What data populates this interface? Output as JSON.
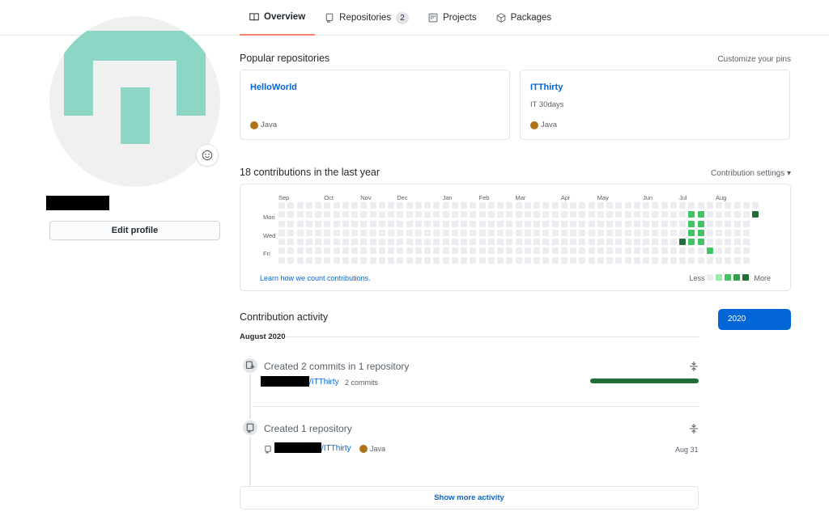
{
  "nav": {
    "tabs": [
      {
        "label": "Overview",
        "icon": "book-icon",
        "active": true
      },
      {
        "label": "Repositories",
        "icon": "repo-icon",
        "count": "2"
      },
      {
        "label": "Projects",
        "icon": "project-icon"
      },
      {
        "label": "Packages",
        "icon": "package-icon"
      }
    ]
  },
  "profile": {
    "avatar_color": "#8dd5c5",
    "edit_label": "Edit profile"
  },
  "popular": {
    "title": "Popular repositories",
    "customize_label": "Customize your pins",
    "repos": [
      {
        "name": "HelloWorld",
        "description": "",
        "language": "Java",
        "language_color": "#b07219"
      },
      {
        "name": "ITThirty",
        "description": "IT 30days",
        "language": "Java",
        "language_color": "#b07219"
      }
    ]
  },
  "contributions": {
    "title": "18 contributions in the last year",
    "settings_label": "Contribution settings ▾",
    "months": [
      "Sep",
      "Oct",
      "Nov",
      "Dec",
      "Jan",
      "Feb",
      "Mar",
      "Apr",
      "May",
      "Jun",
      "Jul",
      "Aug"
    ],
    "days": [
      "Mon",
      "Wed",
      "Fri"
    ],
    "weeks": 53,
    "levels": [
      "#ebedf0",
      "#9be9a8",
      "#40c463",
      "#30a14e",
      "#216e39"
    ],
    "active_cells": [
      {
        "week": 45,
        "day": 1,
        "level": 2
      },
      {
        "week": 46,
        "day": 1,
        "level": 2
      },
      {
        "week": 45,
        "day": 2,
        "level": 2
      },
      {
        "week": 46,
        "day": 2,
        "level": 2
      },
      {
        "week": 45,
        "day": 3,
        "level": 2
      },
      {
        "week": 46,
        "day": 3,
        "level": 2
      },
      {
        "week": 44,
        "day": 4,
        "level": 4
      },
      {
        "week": 45,
        "day": 4,
        "level": 2
      },
      {
        "week": 46,
        "day": 4,
        "level": 2
      },
      {
        "week": 47,
        "day": 5,
        "level": 2
      },
      {
        "week": 52,
        "day": 1,
        "level": 4
      }
    ],
    "learn_label": "Learn how we count contributions.",
    "legend_less": "Less",
    "legend_more": "More"
  },
  "activity": {
    "title": "Contribution activity",
    "year_label": "2020",
    "month_label": "August 2020",
    "items": [
      {
        "title": "Created 2 commits in 1 repository",
        "repo": "/ITThirty",
        "meta": "2 commits",
        "icon": "push-icon"
      },
      {
        "title": "Created 1 repository",
        "repo": "/ITThirty",
        "language": "Java",
        "date": "Aug 31",
        "icon": "repo-icon"
      }
    ],
    "show_more_label": "Show more activity"
  }
}
